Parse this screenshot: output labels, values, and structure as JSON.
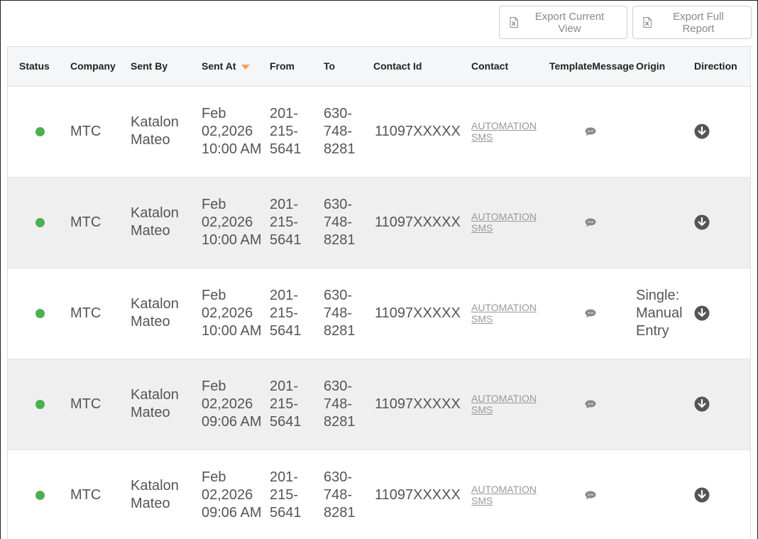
{
  "toolbar": {
    "export_current_label": "Export Current View",
    "export_full_label": "Export Full Report"
  },
  "table": {
    "headers": {
      "status": "Status",
      "company": "Company",
      "sent_by": "Sent By",
      "sent_at": "Sent At",
      "from": "From",
      "to": "To",
      "contact_id": "Contact Id",
      "contact": "Contact",
      "template_message": "TemplateMessage",
      "origin": "Origin",
      "direction": "Direction"
    },
    "rows": [
      {
        "status": "green",
        "company": "MTC",
        "sent_by": "Katalon Mateo",
        "sent_at": "Feb 02,2026 10:00 AM",
        "from": "201-215-5641",
        "to": "630-748-8281",
        "contact_id": "11097XXXXX",
        "contact": "AUTOMATION SMS",
        "origin": ""
      },
      {
        "status": "green",
        "company": "MTC",
        "sent_by": "Katalon Mateo",
        "sent_at": "Feb 02,2026 10:00 AM",
        "from": "201-215-5641",
        "to": "630-748-8281",
        "contact_id": "11097XXXXX",
        "contact": "AUTOMATION SMS",
        "origin": ""
      },
      {
        "status": "green",
        "company": "MTC",
        "sent_by": "Katalon Mateo",
        "sent_at": "Feb 02,2026 10:00 AM",
        "from": "201-215-5641",
        "to": "630-748-8281",
        "contact_id": "11097XXXXX",
        "contact": "AUTOMATION SMS",
        "origin": "Single: Manual Entry"
      },
      {
        "status": "green",
        "company": "MTC",
        "sent_by": "Katalon Mateo",
        "sent_at": "Feb 02,2026 09:06 AM",
        "from": "201-215-5641",
        "to": "630-748-8281",
        "contact_id": "11097XXXXX",
        "contact": "AUTOMATION SMS",
        "origin": ""
      },
      {
        "status": "green",
        "company": "MTC",
        "sent_by": "Katalon Mateo",
        "sent_at": "Feb 02,2026 09:06 AM",
        "from": "201-215-5641",
        "to": "630-748-8281",
        "contact_id": "11097XXXXX",
        "contact": "AUTOMATION SMS",
        "origin": ""
      }
    ]
  },
  "colors": {
    "status_green": "#4caf50",
    "sort_arrow": "#f5a05a",
    "header_bg": "#f5f6f7",
    "alt_row_bg": "#efefef"
  },
  "icons": {
    "export": "excel-file-icon",
    "sort": "sort-desc-icon",
    "template_message": "sms-bubble-icon",
    "direction": "arrow-down-circle-icon"
  }
}
